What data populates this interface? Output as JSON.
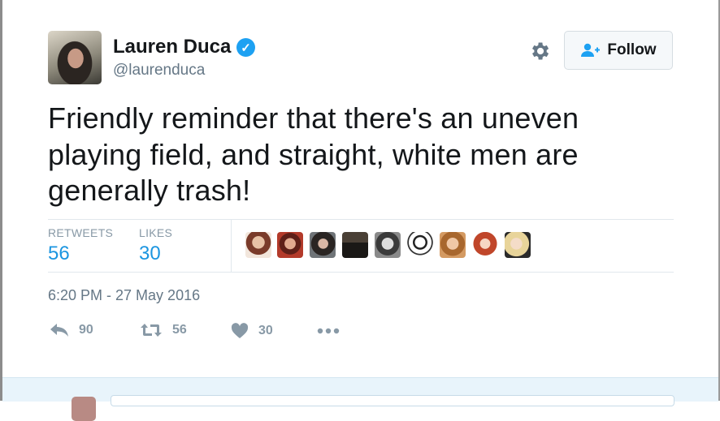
{
  "author": {
    "display_name": "Lauren Duca",
    "handle": "@laurenduca",
    "verified": true
  },
  "follow_button": {
    "label": "Follow"
  },
  "tweet": {
    "text": "Friendly reminder that there's an uneven playing field, and straight, white men are generally trash!",
    "timestamp": "6:20 PM - 27 May 2016"
  },
  "stats": {
    "retweets_label": "RETWEETS",
    "retweets_value": "56",
    "likes_label": "LIKES",
    "likes_value": "30"
  },
  "actions": {
    "reply_count": "90",
    "retweet_count": "56",
    "like_count": "30"
  },
  "colors": {
    "accent": "#1b95e0",
    "verified": "#1da1f2",
    "muted": "#8899a6",
    "text": "#14171a"
  },
  "icons": [
    "verified-icon",
    "gear-icon",
    "follow-user-icon",
    "reply-icon",
    "retweet-icon",
    "heart-icon",
    "more-icon"
  ]
}
